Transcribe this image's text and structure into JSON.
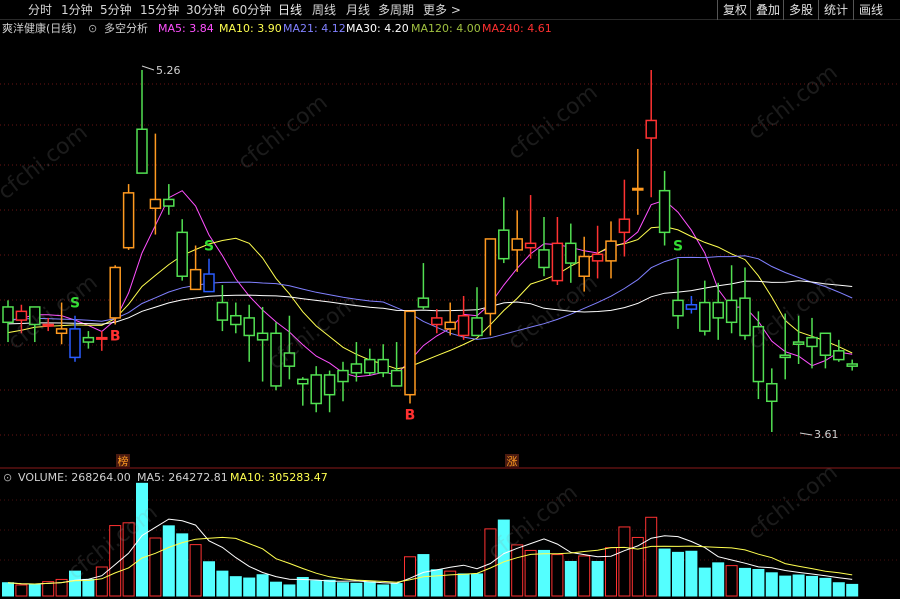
{
  "toolbar": {
    "timeframes": [
      "分时",
      "1分钟",
      "5分钟",
      "15分钟",
      "30分钟",
      "60分钟",
      "日线",
      "周线",
      "月线",
      "多周期",
      "更多 >"
    ],
    "active": "日线",
    "right_buttons": [
      "复权",
      "叠加",
      "多股",
      "统计",
      "画线"
    ]
  },
  "info": {
    "stock_title": "爽洋健康(日线)",
    "indicator_name": "多空分析",
    "ma5": "MA5: 3.84",
    "ma10": "MA10: 3.90",
    "ma21": "MA21: 4.12",
    "ma30": "MA30: 4.20",
    "ma120": "MA120: 4.00",
    "ma240": "MA240: 4.61"
  },
  "volume_info": {
    "volume": "VOLUME: 268264.00",
    "ma5": "MA5: 264272.81",
    "ma10": "MA10: 305283.47"
  },
  "markers": {
    "high_label": "5.26",
    "low_label": "3.61",
    "event_label_1": "榜",
    "event_label_2": "涨"
  },
  "colors": {
    "up": "#ff3232",
    "down": "#54ffff",
    "green_candle": "#52e052",
    "orange_candle": "#ff9a20",
    "blue_candle": "#2a5cff",
    "ma5": "#ff50ff",
    "ma10": "#ffff50",
    "ma21": "#8080ff",
    "ma30": "#ffffff",
    "ma120": "#a0c040",
    "ma240": "#ff3030",
    "signal_s": "#33dd33",
    "signal_b": "#ff3030"
  },
  "chart_data": {
    "type": "candlestick",
    "price_range": [
      3.5,
      5.4
    ],
    "candles": [
      {
        "o": 4.11,
        "h": 4.21,
        "l": 4.02,
        "c": 4.18,
        "k": "g"
      },
      {
        "o": 4.12,
        "h": 4.19,
        "l": 4.06,
        "c": 4.16,
        "k": "r"
      },
      {
        "o": 4.1,
        "h": 4.16,
        "l": 4.02,
        "c": 4.18,
        "k": "g"
      },
      {
        "o": 4.1,
        "h": 4.13,
        "l": 4.07,
        "c": 4.1,
        "k": "r"
      },
      {
        "o": 4.06,
        "h": 4.2,
        "l": 4.01,
        "c": 4.08,
        "k": "o"
      },
      {
        "o": 3.95,
        "h": 4.14,
        "l": 3.93,
        "c": 4.08,
        "k": "b"
      },
      {
        "o": 4.02,
        "h": 4.07,
        "l": 3.99,
        "c": 4.04,
        "k": "g"
      },
      {
        "o": 4.04,
        "h": 4.07,
        "l": 3.98,
        "c": 4.04,
        "k": "r"
      },
      {
        "o": 4.13,
        "h": 4.37,
        "l": 4.1,
        "c": 4.36,
        "k": "o"
      },
      {
        "o": 4.45,
        "h": 4.74,
        "l": 4.44,
        "c": 4.7,
        "k": "o"
      },
      {
        "o": 4.79,
        "h": 5.26,
        "l": 4.79,
        "c": 4.99,
        "k": "g"
      },
      {
        "o": 4.63,
        "h": 4.97,
        "l": 4.51,
        "c": 4.67,
        "k": "o"
      },
      {
        "o": 4.64,
        "h": 4.74,
        "l": 4.6,
        "c": 4.67,
        "k": "g"
      },
      {
        "o": 4.32,
        "h": 4.58,
        "l": 4.3,
        "c": 4.52,
        "k": "g"
      },
      {
        "o": 4.26,
        "h": 4.46,
        "l": 4.26,
        "c": 4.35,
        "k": "o"
      },
      {
        "o": 4.25,
        "h": 4.4,
        "l": 4.25,
        "c": 4.33,
        "k": "b"
      },
      {
        "o": 4.12,
        "h": 4.28,
        "l": 4.07,
        "c": 4.2,
        "k": "g"
      },
      {
        "o": 4.1,
        "h": 4.2,
        "l": 4.06,
        "c": 4.14,
        "k": "g"
      },
      {
        "o": 4.05,
        "h": 4.19,
        "l": 3.93,
        "c": 4.13,
        "k": "g"
      },
      {
        "o": 4.06,
        "h": 4.18,
        "l": 3.84,
        "c": 4.03,
        "k": "g"
      },
      {
        "o": 3.82,
        "h": 4.11,
        "l": 3.8,
        "c": 4.06,
        "k": "g"
      },
      {
        "o": 3.91,
        "h": 4.14,
        "l": 3.85,
        "c": 3.97,
        "k": "g"
      },
      {
        "o": 3.83,
        "h": 3.86,
        "l": 3.73,
        "c": 3.85,
        "k": "g"
      },
      {
        "o": 3.74,
        "h": 3.91,
        "l": 3.7,
        "c": 3.87,
        "k": "g"
      },
      {
        "o": 3.78,
        "h": 3.89,
        "l": 3.7,
        "c": 3.87,
        "k": "g"
      },
      {
        "o": 3.89,
        "h": 3.93,
        "l": 3.75,
        "c": 3.84,
        "k": "g"
      },
      {
        "o": 3.92,
        "h": 4.02,
        "l": 3.84,
        "c": 3.88,
        "k": "g"
      },
      {
        "o": 3.94,
        "h": 3.99,
        "l": 3.87,
        "c": 3.88,
        "k": "g"
      },
      {
        "o": 3.88,
        "h": 4.01,
        "l": 3.86,
        "c": 3.94,
        "k": "g"
      },
      {
        "o": 3.89,
        "h": 4.02,
        "l": 3.83,
        "c": 3.82,
        "k": "g"
      },
      {
        "o": 3.78,
        "h": 4.16,
        "l": 3.74,
        "c": 4.16,
        "k": "o"
      },
      {
        "o": 4.18,
        "h": 4.38,
        "l": 4.17,
        "c": 4.22,
        "k": "g"
      },
      {
        "o": 4.13,
        "h": 4.17,
        "l": 4.06,
        "c": 4.1,
        "k": "r"
      },
      {
        "o": 4.08,
        "h": 4.2,
        "l": 4.05,
        "c": 4.11,
        "k": "o"
      },
      {
        "o": 4.05,
        "h": 4.23,
        "l": 4.03,
        "c": 4.14,
        "k": "r"
      },
      {
        "o": 4.05,
        "h": 4.27,
        "l": 4.05,
        "c": 4.13,
        "k": "g"
      },
      {
        "o": 4.15,
        "h": 4.48,
        "l": 4.05,
        "c": 4.49,
        "k": "o"
      },
      {
        "o": 4.4,
        "h": 4.68,
        "l": 4.38,
        "c": 4.53,
        "k": "g"
      },
      {
        "o": 4.44,
        "h": 4.62,
        "l": 4.34,
        "c": 4.49,
        "k": "o"
      },
      {
        "o": 4.45,
        "h": 4.69,
        "l": 4.4,
        "c": 4.47,
        "k": "r"
      },
      {
        "o": 4.44,
        "h": 4.59,
        "l": 4.32,
        "c": 4.36,
        "k": "g"
      },
      {
        "o": 4.3,
        "h": 4.59,
        "l": 4.28,
        "c": 4.47,
        "k": "r"
      },
      {
        "o": 4.38,
        "h": 4.56,
        "l": 4.29,
        "c": 4.47,
        "k": "g"
      },
      {
        "o": 4.32,
        "h": 4.5,
        "l": 4.25,
        "c": 4.41,
        "k": "o"
      },
      {
        "o": 4.39,
        "h": 4.55,
        "l": 4.31,
        "c": 4.42,
        "k": "r"
      },
      {
        "o": 4.39,
        "h": 4.57,
        "l": 4.31,
        "c": 4.48,
        "k": "o"
      },
      {
        "o": 4.52,
        "h": 4.76,
        "l": 4.41,
        "c": 4.58,
        "k": "r"
      },
      {
        "o": 4.72,
        "h": 4.9,
        "l": 4.6,
        "c": 4.72,
        "k": "o"
      },
      {
        "o": 4.95,
        "h": 5.26,
        "l": 4.68,
        "c": 5.03,
        "k": "r"
      },
      {
        "o": 4.71,
        "h": 4.8,
        "l": 4.46,
        "c": 4.52,
        "k": "g"
      },
      {
        "o": 4.14,
        "h": 4.4,
        "l": 4.08,
        "c": 4.21,
        "k": "g"
      },
      {
        "o": 4.19,
        "h": 4.23,
        "l": 4.15,
        "c": 4.17,
        "k": "b"
      },
      {
        "o": 4.07,
        "h": 4.3,
        "l": 4.05,
        "c": 4.2,
        "k": "g"
      },
      {
        "o": 4.13,
        "h": 4.29,
        "l": 4.03,
        "c": 4.2,
        "k": "g"
      },
      {
        "o": 4.21,
        "h": 4.37,
        "l": 4.06,
        "c": 4.11,
        "k": "g"
      },
      {
        "o": 4.05,
        "h": 4.36,
        "l": 4.03,
        "c": 4.22,
        "k": "g"
      },
      {
        "o": 4.09,
        "h": 4.16,
        "l": 3.76,
        "c": 3.84,
        "k": "g"
      },
      {
        "o": 3.83,
        "h": 3.9,
        "l": 3.61,
        "c": 3.75,
        "k": "g"
      },
      {
        "o": 3.95,
        "h": 4.15,
        "l": 3.85,
        "c": 3.96,
        "k": "g"
      },
      {
        "o": 4.02,
        "h": 4.14,
        "l": 3.92,
        "c": 4.01,
        "k": "g"
      },
      {
        "o": 4.04,
        "h": 4.13,
        "l": 3.9,
        "c": 4.0,
        "k": "g"
      },
      {
        "o": 4.06,
        "h": 4.06,
        "l": 3.9,
        "c": 3.96,
        "k": "g"
      },
      {
        "o": 3.98,
        "h": 4.03,
        "l": 3.93,
        "c": 3.94,
        "k": "g"
      },
      {
        "o": 3.92,
        "h": 3.94,
        "l": 3.89,
        "c": 3.91,
        "k": "g"
      }
    ],
    "volume_range": [
      0,
      420000
    ],
    "volumes": [
      {
        "v": 48000,
        "k": "c"
      },
      {
        "v": 40000,
        "k": "r"
      },
      {
        "v": 42000,
        "k": "c"
      },
      {
        "v": 52000,
        "k": "r"
      },
      {
        "v": 60000,
        "k": "r"
      },
      {
        "v": 90000,
        "k": "c"
      },
      {
        "v": 60000,
        "k": "c"
      },
      {
        "v": 105000,
        "k": "r"
      },
      {
        "v": 255000,
        "k": "r"
      },
      {
        "v": 265000,
        "k": "r"
      },
      {
        "v": 408000,
        "k": "c"
      },
      {
        "v": 210000,
        "k": "r"
      },
      {
        "v": 254000,
        "k": "c"
      },
      {
        "v": 225000,
        "k": "c"
      },
      {
        "v": 186000,
        "k": "r"
      },
      {
        "v": 124000,
        "k": "c"
      },
      {
        "v": 90000,
        "k": "c"
      },
      {
        "v": 70000,
        "k": "c"
      },
      {
        "v": 65000,
        "k": "c"
      },
      {
        "v": 77000,
        "k": "c"
      },
      {
        "v": 50000,
        "k": "c"
      },
      {
        "v": 40000,
        "k": "c"
      },
      {
        "v": 67000,
        "k": "c"
      },
      {
        "v": 55000,
        "k": "c"
      },
      {
        "v": 57000,
        "k": "c"
      },
      {
        "v": 48000,
        "k": "c"
      },
      {
        "v": 46000,
        "k": "c"
      },
      {
        "v": 50000,
        "k": "c"
      },
      {
        "v": 40000,
        "k": "c"
      },
      {
        "v": 45000,
        "k": "c"
      },
      {
        "v": 142000,
        "k": "r"
      },
      {
        "v": 150000,
        "k": "c"
      },
      {
        "v": 95000,
        "k": "c"
      },
      {
        "v": 90000,
        "k": "r"
      },
      {
        "v": 80000,
        "k": "c"
      },
      {
        "v": 80000,
        "k": "c"
      },
      {
        "v": 243000,
        "k": "r"
      },
      {
        "v": 275000,
        "k": "c"
      },
      {
        "v": 185000,
        "k": "r"
      },
      {
        "v": 165000,
        "k": "r"
      },
      {
        "v": 165000,
        "k": "c"
      },
      {
        "v": 150000,
        "k": "r"
      },
      {
        "v": 125000,
        "k": "c"
      },
      {
        "v": 145000,
        "k": "r"
      },
      {
        "v": 125000,
        "k": "c"
      },
      {
        "v": 175000,
        "k": "r"
      },
      {
        "v": 250000,
        "k": "r"
      },
      {
        "v": 212000,
        "k": "r"
      },
      {
        "v": 285000,
        "k": "r"
      },
      {
        "v": 170000,
        "k": "c"
      },
      {
        "v": 158000,
        "k": "c"
      },
      {
        "v": 162000,
        "k": "c"
      },
      {
        "v": 101000,
        "k": "c"
      },
      {
        "v": 120000,
        "k": "c"
      },
      {
        "v": 110000,
        "k": "r"
      },
      {
        "v": 100000,
        "k": "c"
      },
      {
        "v": 96000,
        "k": "c"
      },
      {
        "v": 84000,
        "k": "c"
      },
      {
        "v": 72000,
        "k": "c"
      },
      {
        "v": 76000,
        "k": "c"
      },
      {
        "v": 71000,
        "k": "c"
      },
      {
        "v": 64000,
        "k": "c"
      },
      {
        "v": 48000,
        "k": "c"
      },
      {
        "v": 42000,
        "k": "c"
      }
    ],
    "signals": [
      {
        "i": 5,
        "t": "S"
      },
      {
        "i": 8,
        "t": "B"
      },
      {
        "i": 15,
        "t": "S"
      },
      {
        "i": 30,
        "t": "B"
      },
      {
        "i": 50,
        "t": "S"
      }
    ]
  }
}
